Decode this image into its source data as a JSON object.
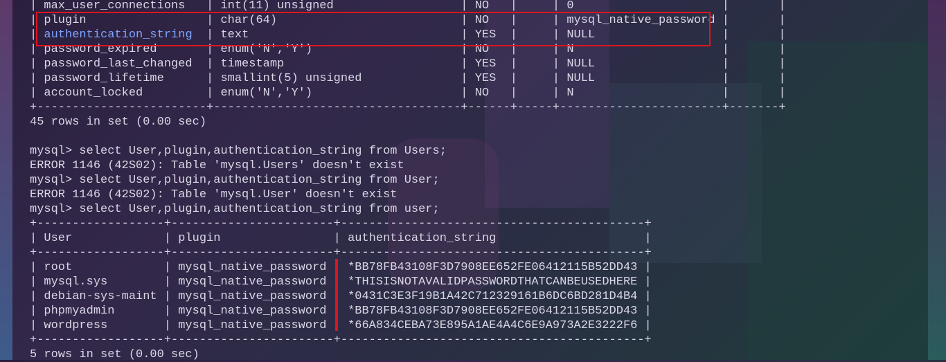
{
  "terminal": {
    "lines": [
      "| max_user_connections   | int(11) unsigned                  | NO   |     | 0                     |       |",
      "| plugin                 | char(64)                          | NO   |     | mysql_native_password |       |",
      "| authentication_string  | text                              | YES  |     | NULL                  |       |",
      "| password_expired       | enum('N','Y')                     | NO   |     | N                     |       |",
      "| password_last_changed  | timestamp                         | YES  |     | NULL                  |       |",
      "| password_lifetime      | smallint(5) unsigned              | YES  |     | NULL                  |       |",
      "| account_locked         | enum('N','Y')                     | NO   |     | N                     |       |",
      "+------------------------+-----------------------------------+------+-----+-----------------------+-------+",
      "45 rows in set (0.00 sec)",
      "",
      "mysql> select User,plugin,authentication_string from Users;",
      "ERROR 1146 (42S02): Table 'mysql.Users' doesn't exist",
      "mysql> select User,plugin,authentication_string from User;",
      "ERROR 1146 (42S02): Table 'mysql.User' doesn't exist",
      "mysql> select User,plugin,authentication_string from user;",
      "+------------------+-----------------------+-------------------------------------------+",
      "| User             | plugin                | authentication_string                     |",
      "+------------------+-----------------------+-------------------------------------------+",
      "| root             | mysql_native_password | *BB78FB43108F3D7908EE652FE06412115B52DD43 |",
      "| mysql.sys        | mysql_native_password | *THISISNOTAVALIDPASSWORDTHATCANBEUSEDHERE |",
      "| debian-sys-maint | mysql_native_password | *0431C3E3F19B1A42C712329161B6DC6BD281D4B4 |",
      "| phpmyadmin       | mysql_native_password | *BB78FB43108F3D7908EE652FE06412115B52DD43 |",
      "| wordpress        | mysql_native_password | *66A834CEBA73E895A1AE4A4C6E9A973A2E3222F6 |",
      "+------------------+-----------------------+-------------------------------------------+",
      "5 rows in set (0.00 sec)"
    ],
    "highlight_text": "authentication_string",
    "highlight_color": "#7ea3ff",
    "text_color": "#d9d6e6",
    "annotation_color": "#e0141e"
  }
}
